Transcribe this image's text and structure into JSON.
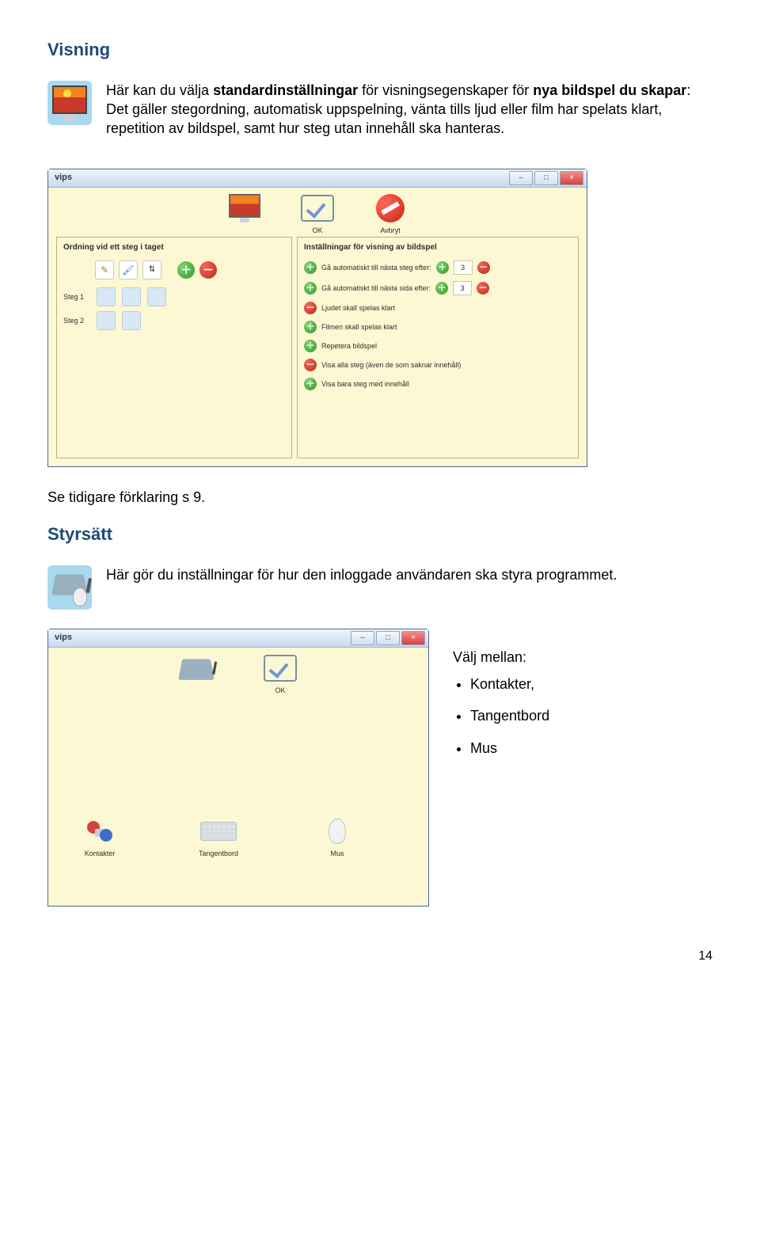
{
  "section1": {
    "heading": "Visning",
    "intro_prefix": "Här kan du välja ",
    "intro_bold1": "standardinställningar",
    "intro_mid": " för visningsegenskaper för ",
    "intro_bold2": "nya bildspel du skapar",
    "intro_suffix": ": Det gäller stegordning, automatisk uppspelning, vänta tills ljud eller film har spelats klart, repetition av bildspel, samt hur steg utan innehåll ska hanteras."
  },
  "window1": {
    "title": "vips",
    "toolbar": {
      "ok": "OK",
      "cancel": "Avbryt"
    },
    "left_pane_title": "Ordning vid ett steg i taget",
    "steps": [
      "Steg 1",
      "Steg 2"
    ],
    "right_pane_title": "Inställningar för visning av bildspel",
    "settings": {
      "auto_next_step": "Gå automatiskt till nästa steg efter:",
      "auto_next_step_value": "3",
      "auto_next_page": "Gå automatiskt till nästa sida efter:",
      "auto_next_page_value": "3",
      "wait_audio": "Ljudet skall spelas klart",
      "wait_film": "Filmen skall spelas klart",
      "repeat": "Repetera bildspel",
      "show_all": "Visa alla steg (även de som saknar innehåll)",
      "show_only": "Visa bara steg med innehåll"
    }
  },
  "after1": "Se tidigare förklaring s 9.",
  "section2": {
    "heading": "Styrsätt",
    "intro": "Här gör du inställningar för hur den inloggade användaren ska styra programmet."
  },
  "window2": {
    "title": "vips",
    "toolbar": {
      "ok": "OK"
    },
    "items": {
      "kontakter": "Kontakter",
      "tangentbord": "Tangentbord",
      "mus": "Mus"
    }
  },
  "right_col": {
    "choose": "Välj mellan:",
    "bullets": [
      "Kontakter,",
      "Tangentbord",
      "Mus"
    ]
  },
  "page_number": "14"
}
